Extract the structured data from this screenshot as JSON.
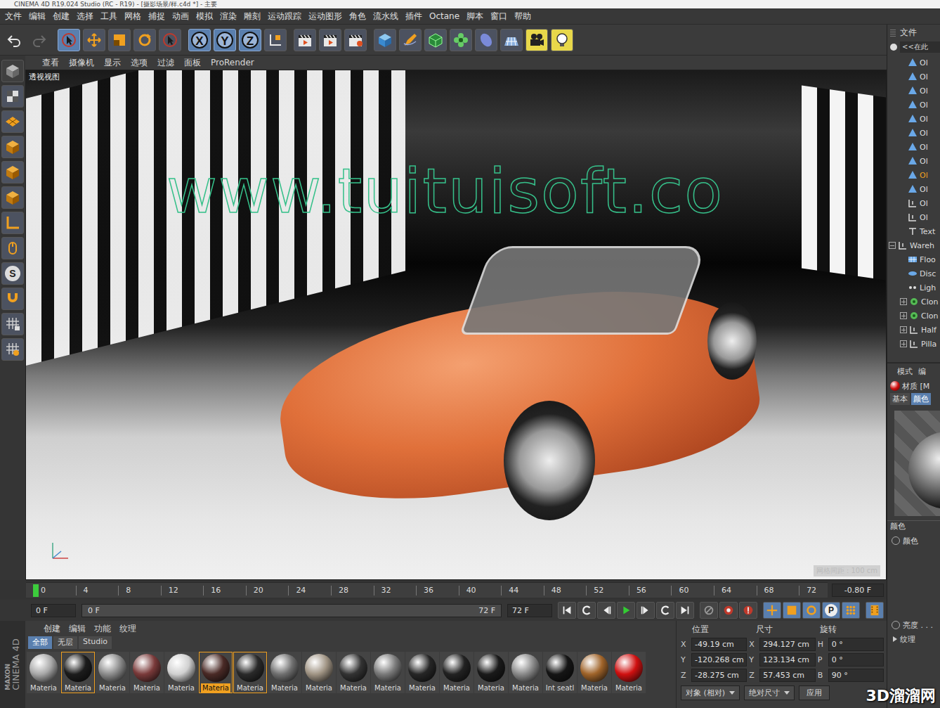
{
  "window": {
    "title": "CINEMA 4D R19.024 Studio (RC - R19) - [摄影场景/样.c4d *] - 主要"
  },
  "menu": [
    "文件",
    "编辑",
    "创建",
    "选择",
    "工具",
    "网格",
    "捕捉",
    "动画",
    "模拟",
    "渲染",
    "雕刻",
    "运动跟踪",
    "运动图形",
    "角色",
    "流水线",
    "插件",
    "Octane",
    "脚本",
    "窗口",
    "帮助"
  ],
  "toolbar": {
    "undo_enabled": true,
    "redo_enabled": false,
    "active_tool": "select",
    "axis_locks": [
      {
        "label": "X",
        "on": true
      },
      {
        "label": "Y",
        "on": true
      },
      {
        "label": "Z",
        "on": true
      }
    ]
  },
  "left_tools": {
    "snap_label": "S"
  },
  "viewport": {
    "menu": [
      "查看",
      "摄像机",
      "显示",
      "选项",
      "过滤",
      "面板",
      "ProRender"
    ],
    "view_name": "透视视图",
    "watermark": "www.tuituisoft.co",
    "grid_spacing": "网格间距 : 100 cm"
  },
  "timeline": {
    "ticks": [
      "0",
      "4",
      "8",
      "12",
      "16",
      "20",
      "24",
      "28",
      "32",
      "36",
      "40",
      "44",
      "48",
      "52",
      "56",
      "60",
      "64",
      "68",
      "72"
    ],
    "frame_readout": "-0.80 F"
  },
  "transport": {
    "start": "0 F",
    "range_start": "0 F",
    "range_end": "72 F",
    "end": "72 F",
    "keyframe_label": "P"
  },
  "materials": {
    "menu": [
      "创建",
      "编辑",
      "功能",
      "纹理"
    ],
    "tabs": [
      {
        "label": "全部",
        "selected": true
      },
      {
        "label": "无层",
        "selected": false
      },
      {
        "label": "Studio",
        "selected": false
      }
    ],
    "items": [
      {
        "label": "Materia",
        "color": "#a8a8a8",
        "selected": false,
        "outlined": false
      },
      {
        "label": "Materia",
        "color": "#1c1c1c",
        "selected": false,
        "outlined": true
      },
      {
        "label": "Materia",
        "color": "#8c8c8c",
        "selected": false,
        "outlined": false
      },
      {
        "label": "Materia",
        "color": "#7a3a3a",
        "selected": false,
        "outlined": false
      },
      {
        "label": "Materia",
        "color": "#d0d0d0",
        "selected": false,
        "outlined": false
      },
      {
        "label": "Materia",
        "color": "#4a2a26",
        "selected": true,
        "outlined": false
      },
      {
        "label": "Materia",
        "color": "#2a2a2a",
        "selected": false,
        "outlined": true
      },
      {
        "label": "Materia",
        "color": "#707070",
        "selected": false,
        "outlined": false
      },
      {
        "label": "Materia",
        "color": "#a09484",
        "selected": false,
        "outlined": false
      },
      {
        "label": "Materia",
        "color": "#333333",
        "selected": false,
        "outlined": false
      },
      {
        "label": "Materia",
        "color": "#7a7a7a",
        "selected": false,
        "outlined": false
      },
      {
        "label": "Materia",
        "color": "#262626",
        "selected": false,
        "outlined": false
      },
      {
        "label": "Materia",
        "color": "#222222",
        "selected": false,
        "outlined": false
      },
      {
        "label": "Materia",
        "color": "#1a1a1a",
        "selected": false,
        "outlined": false
      },
      {
        "label": "Materia",
        "color": "#8a8a8a",
        "selected": false,
        "outlined": false
      },
      {
        "label": "Int seatl",
        "color": "#151515",
        "selected": false,
        "outlined": false
      },
      {
        "label": "Materia",
        "color": "#a0642a",
        "selected": false,
        "outlined": false
      },
      {
        "label": "Materia",
        "color": "#d01010",
        "selected": false,
        "outlined": false
      }
    ]
  },
  "coordinates": {
    "headers": [
      "位置",
      "尺寸",
      "旋转"
    ],
    "rows": [
      {
        "axis": "X",
        "position": "-49.19 cm",
        "size_axis": "X",
        "size": "294.127 cm",
        "rot_axis": "H",
        "rotation": "0 °"
      },
      {
        "axis": "Y",
        "position": "-120.268 cm",
        "size_axis": "Y",
        "size": "123.134 cm",
        "rot_axis": "P",
        "rotation": "0 °"
      },
      {
        "axis": "Z",
        "position": "-28.275 cm",
        "size_axis": "Z",
        "size": "57.453 cm",
        "rot_axis": "B",
        "rotation": "90 °"
      }
    ],
    "mode": "对象 (相对)",
    "size_mode": "绝对尺寸",
    "apply": "应用"
  },
  "objects": {
    "header": "文件",
    "search": "<<在此",
    "items": [
      {
        "label": "Ol",
        "kind": "polygon",
        "depth": 1,
        "expander": "none",
        "selected": false
      },
      {
        "label": "Ol",
        "kind": "polygon",
        "depth": 1,
        "expander": "none",
        "selected": false
      },
      {
        "label": "Ol",
        "kind": "polygon",
        "depth": 1,
        "expander": "none",
        "selected": false
      },
      {
        "label": "Ol",
        "kind": "polygon",
        "depth": 1,
        "expander": "none",
        "selected": false
      },
      {
        "label": "Ol",
        "kind": "polygon",
        "depth": 1,
        "expander": "none",
        "selected": false
      },
      {
        "label": "Ol",
        "kind": "polygon",
        "depth": 1,
        "expander": "none",
        "selected": false
      },
      {
        "label": "Ol",
        "kind": "polygon",
        "depth": 1,
        "expander": "none",
        "selected": false
      },
      {
        "label": "Ol",
        "kind": "polygon",
        "depth": 1,
        "expander": "none",
        "selected": false
      },
      {
        "label": "Ol",
        "kind": "polygon",
        "depth": 1,
        "expander": "none",
        "selected": true
      },
      {
        "label": "Ol",
        "kind": "polygon",
        "depth": 1,
        "expander": "none",
        "selected": false
      },
      {
        "label": "Ol",
        "kind": "null",
        "depth": 1,
        "expander": "none",
        "selected": false
      },
      {
        "label": "Ol",
        "kind": "null",
        "depth": 1,
        "expander": "none",
        "selected": false
      },
      {
        "label": "Text",
        "kind": "text",
        "depth": 1,
        "expander": "none",
        "selected": false
      },
      {
        "label": "Wareh",
        "kind": "null",
        "depth": 0,
        "expander": "open",
        "selected": false
      },
      {
        "label": "Floo",
        "kind": "floor",
        "depth": 1,
        "expander": "none",
        "selected": false
      },
      {
        "label": "Disc",
        "kind": "disc",
        "depth": 1,
        "expander": "none",
        "selected": false
      },
      {
        "label": "Ligh",
        "kind": "light",
        "depth": 1,
        "expander": "none",
        "selected": false
      },
      {
        "label": "Clon",
        "kind": "cloner",
        "depth": 1,
        "expander": "closed",
        "selected": false
      },
      {
        "label": "Clon",
        "kind": "cloner",
        "depth": 1,
        "expander": "closed",
        "selected": false
      },
      {
        "label": "Half",
        "kind": "null",
        "depth": 1,
        "expander": "closed",
        "selected": false
      },
      {
        "label": "Pilla",
        "kind": "null",
        "depth": 1,
        "expander": "closed",
        "selected": false
      }
    ]
  },
  "attributes": {
    "tabs": [
      "模式",
      "编"
    ],
    "title": "材质 [M",
    "subtabs": [
      {
        "label": "基本",
        "selected": false
      },
      {
        "label": "颜色",
        "selected": true
      }
    ],
    "section": "颜色",
    "color_row": "颜色",
    "brightness": "亮度 . . .",
    "texture": "纹理"
  },
  "branding": {
    "logo_top": "MAXON",
    "logo_bottom": "CINEMA 4D",
    "corner_watermark": "3D溜溜网"
  }
}
